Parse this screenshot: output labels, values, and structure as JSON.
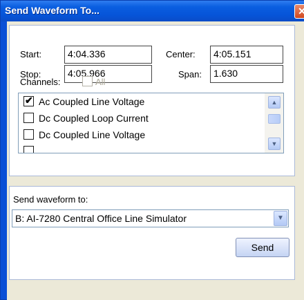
{
  "window": {
    "title": "Send Waveform To...",
    "close_glyph": "✕"
  },
  "range": {
    "start_label": "Start:",
    "start_value": "4:04.336",
    "center_label": "Center:",
    "center_value": "4:05.151",
    "stop_label": "Stop:",
    "stop_value": "4:05.966",
    "span_label": "Span:",
    "span_value": "1.630"
  },
  "channels": {
    "label": "Channels:",
    "all_label": "All",
    "items": [
      {
        "label": "Ac Coupled Line Voltage",
        "checked": true
      },
      {
        "label": "Dc Coupled Loop Current",
        "checked": false
      },
      {
        "label": "Dc Coupled Line Voltage",
        "checked": false
      }
    ]
  },
  "destination": {
    "label": "Send waveform to:",
    "selected": "B:  AI-7280  Central Office Line Simulator",
    "send_label": "Send"
  },
  "icons": {
    "check": "✔",
    "scroll_up": "▲",
    "scroll_down": "▼",
    "dropdown": "▼"
  },
  "colors": {
    "titlebar": "#0a5ee0",
    "client": "#ece9d8",
    "close": "#d1481f"
  }
}
